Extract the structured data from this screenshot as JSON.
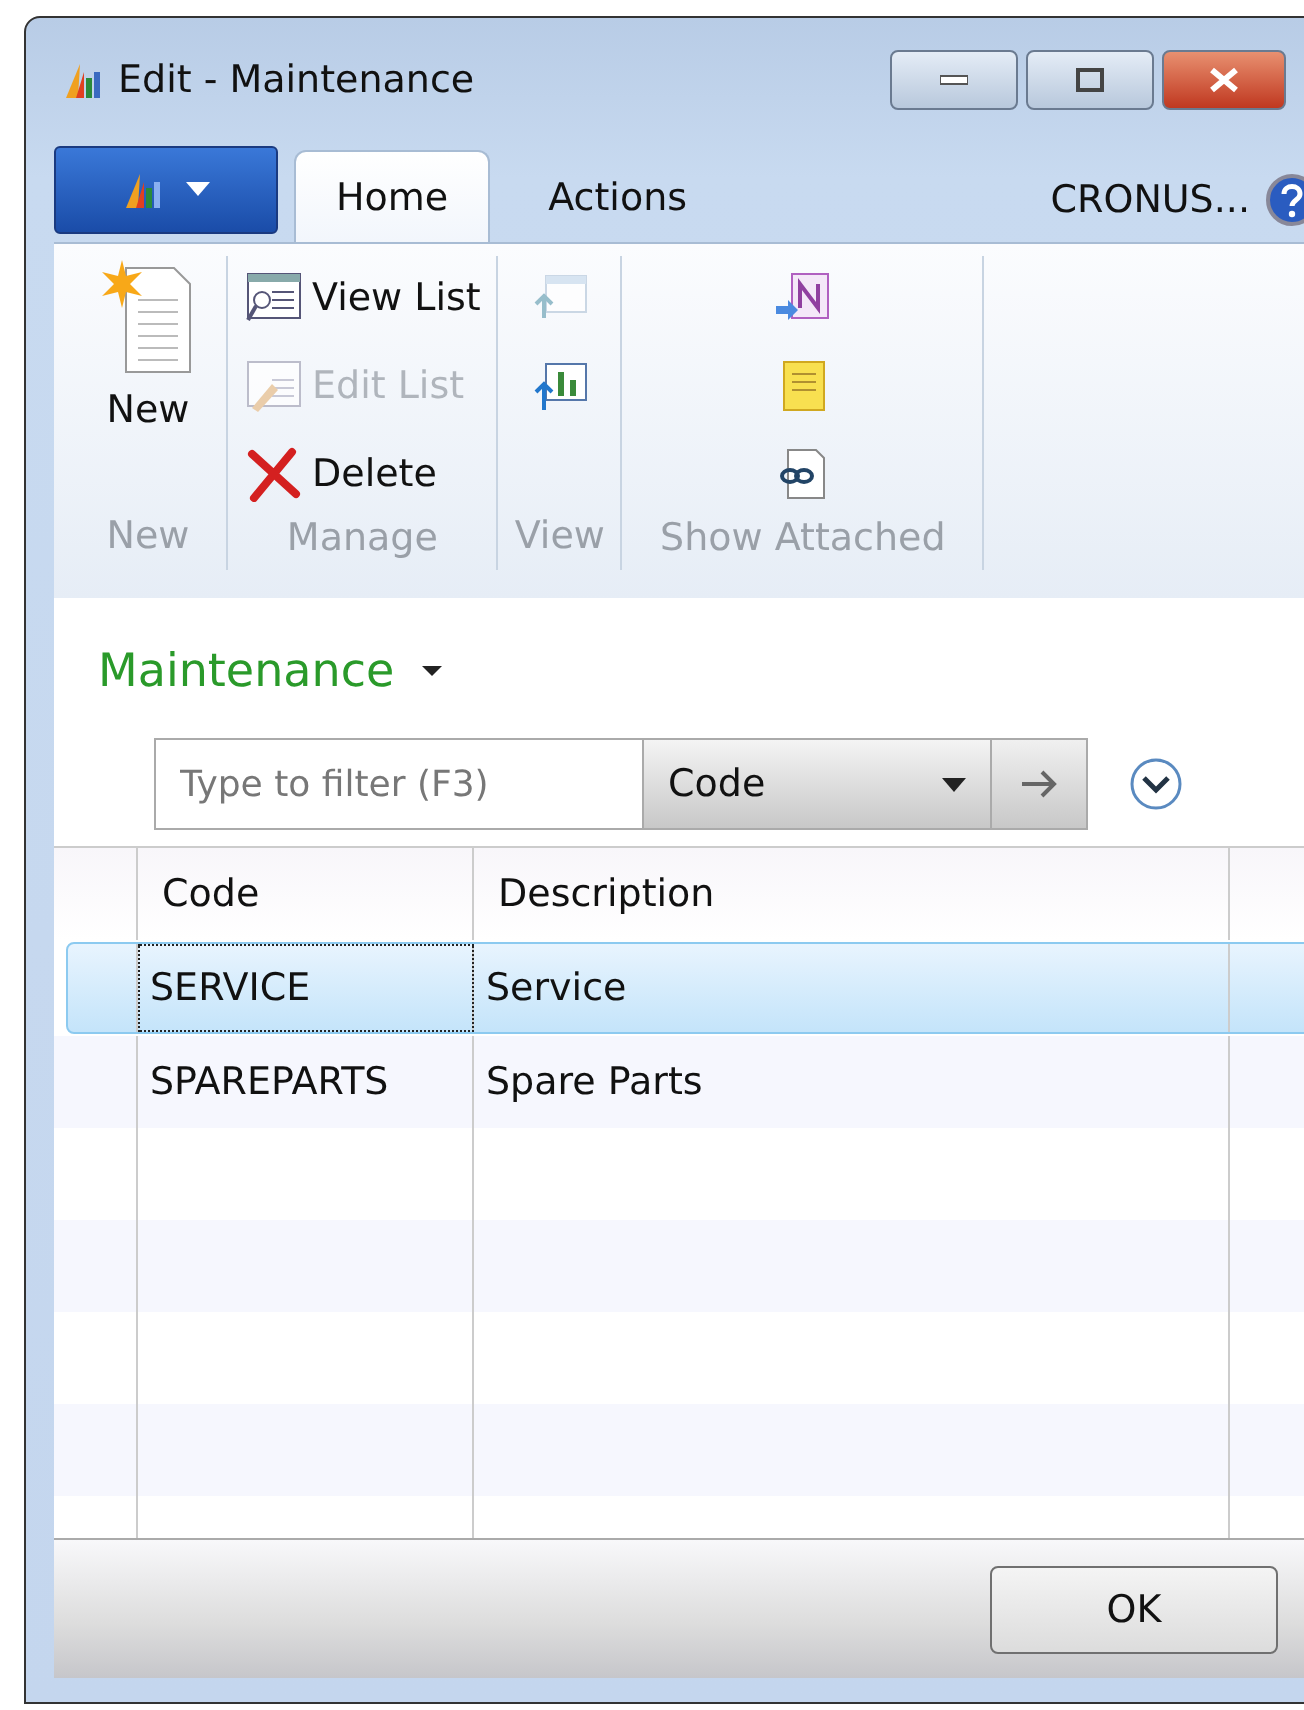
{
  "window": {
    "title": "Edit - Maintenance"
  },
  "tabs": [
    {
      "label": "Home",
      "selected": true
    },
    {
      "label": "Actions",
      "selected": false
    }
  ],
  "company": "CRONUS...",
  "ribbon_groups": [
    {
      "label": "New",
      "items": [
        {
          "label": "New",
          "disabled": false
        }
      ]
    },
    {
      "label": "Manage",
      "items": [
        {
          "label": "View List",
          "disabled": false
        },
        {
          "label": "Edit List",
          "disabled": true
        },
        {
          "label": "Delete",
          "disabled": false
        }
      ]
    },
    {
      "label": "View",
      "items": [
        {
          "disabled": true
        },
        {
          "disabled": false
        }
      ]
    },
    {
      "label": "Show Attached",
      "items": [
        {
          "disabled": false
        },
        {
          "disabled": false
        },
        {
          "disabled": false
        }
      ]
    }
  ],
  "page_title": "Maintenance",
  "filter": {
    "placeholder": "Type to filter (F3)",
    "field": "Code"
  },
  "table": {
    "columns": [
      "Code",
      "Description"
    ],
    "rows": [
      {
        "cells": [
          "SERVICE",
          "Service"
        ],
        "selected": true
      },
      {
        "cells": [
          "SPAREPARTS",
          "Spare Parts"
        ],
        "selected": false
      }
    ]
  },
  "buttons": [
    "OK"
  ]
}
